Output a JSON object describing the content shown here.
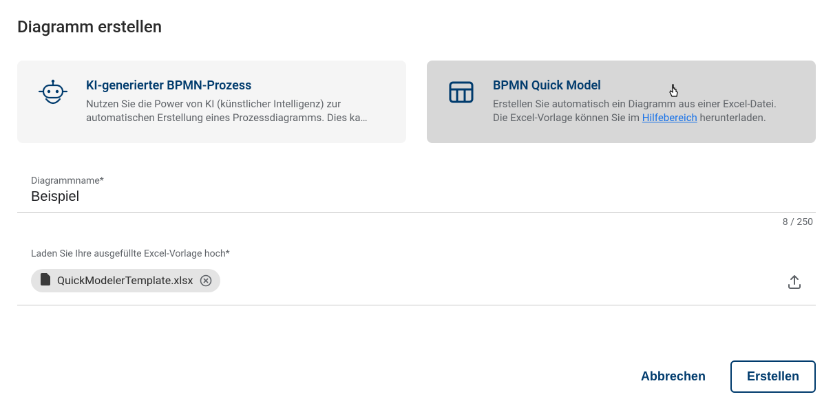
{
  "title": "Diagramm erstellen",
  "cards": {
    "ai": {
      "title": "KI-generierter BPMN-Prozess",
      "desc_line1": "Nutzen Sie die Power von KI (künstlicher Intelligenz) zur",
      "desc_line2": "automatischen Erstellung eines Prozessdiagramms. Dies ka…"
    },
    "quick": {
      "title": "BPMN Quick Model",
      "desc_line1": "Erstellen Sie automatisch ein Diagramm aus einer Excel-Datei.",
      "desc_prefix": "Die Excel-Vorlage können Sie im ",
      "help_link_label": "Hilfebereich",
      "desc_suffix": " herunterladen."
    }
  },
  "name_field": {
    "label": "Diagrammname*",
    "value": "Beispiel",
    "counter": "8 / 250"
  },
  "upload_field": {
    "label": "Laden Sie Ihre ausgefüllte Excel-Vorlage hoch*",
    "filename": "QuickModelerTemplate.xlsx"
  },
  "actions": {
    "cancel": "Abbrechen",
    "create": "Erstellen"
  }
}
